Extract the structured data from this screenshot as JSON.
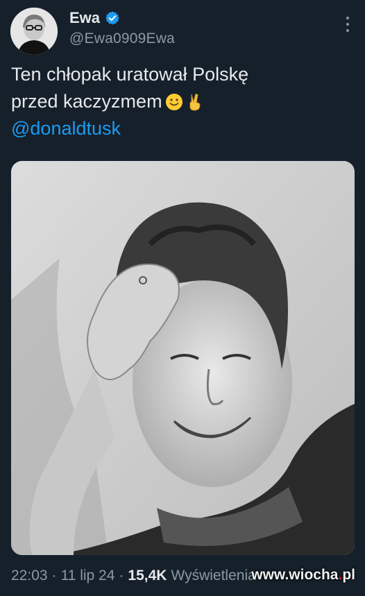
{
  "author": {
    "name": "Ewa",
    "handle": "@Ewa0909Ewa",
    "verified_color": "#1d9bf0"
  },
  "tweet": {
    "line1": "Ten chłopak uratował Polskę",
    "line2": "przed kaczyzmem",
    "emojis": [
      "slightly-smiling-face-icon",
      "victory-hand-icon"
    ],
    "mention": "@donaldtusk"
  },
  "media": {
    "description_icon": "photo"
  },
  "meta": {
    "time": "22:03",
    "sep1": "·",
    "date": "11 lip 24",
    "sep2": "·",
    "views": "15,4K",
    "views_label": "Wyświetlenia"
  },
  "watermark": {
    "prefix": "www.wiocha",
    "dot": ".",
    "suffix": "pl"
  },
  "colors": {
    "background": "#15202b",
    "text": "#e7e9ea",
    "secondary": "#8b98a5",
    "accent": "#1d9bf0"
  }
}
